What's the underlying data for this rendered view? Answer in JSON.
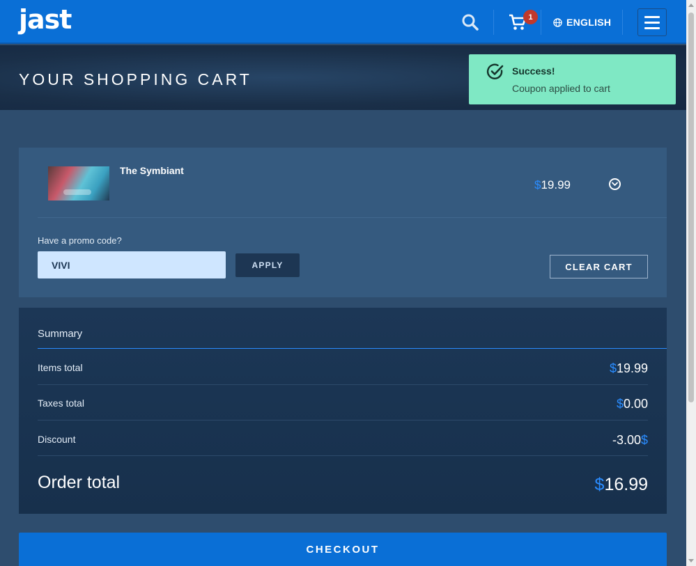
{
  "nav": {
    "logo": "jast",
    "cart_count": "1",
    "language": "ENGLISH"
  },
  "banner": {
    "title": "YOUR SHOPPING CART"
  },
  "toast": {
    "title": "Success!",
    "message": "Coupon applied to cart"
  },
  "cart": {
    "item": {
      "title": "The Symbiant",
      "currency": "$",
      "price": "19.99"
    },
    "promo": {
      "label": "Have a promo code?",
      "value": "VIVI",
      "apply_label": "APPLY"
    },
    "clear_label": "CLEAR CART"
  },
  "summary": {
    "heading": "Summary",
    "items_label": "Items total",
    "items_value": "19.99",
    "taxes_label": "Taxes total",
    "taxes_value": "0.00",
    "discount_label": "Discount",
    "discount_value": "-3.00",
    "order_label": "Order total",
    "order_value": "16.99",
    "currency": "$"
  },
  "checkout_label": "CHECKOUT",
  "colors": {
    "primary": "#0a6fd6",
    "accent_dollar": "#2a8cff",
    "toast": "#7fe8c4"
  },
  "icons": [
    "search-icon",
    "cart-icon",
    "globe-icon",
    "menu-icon",
    "check-circle-icon",
    "chevron-down-icon"
  ]
}
